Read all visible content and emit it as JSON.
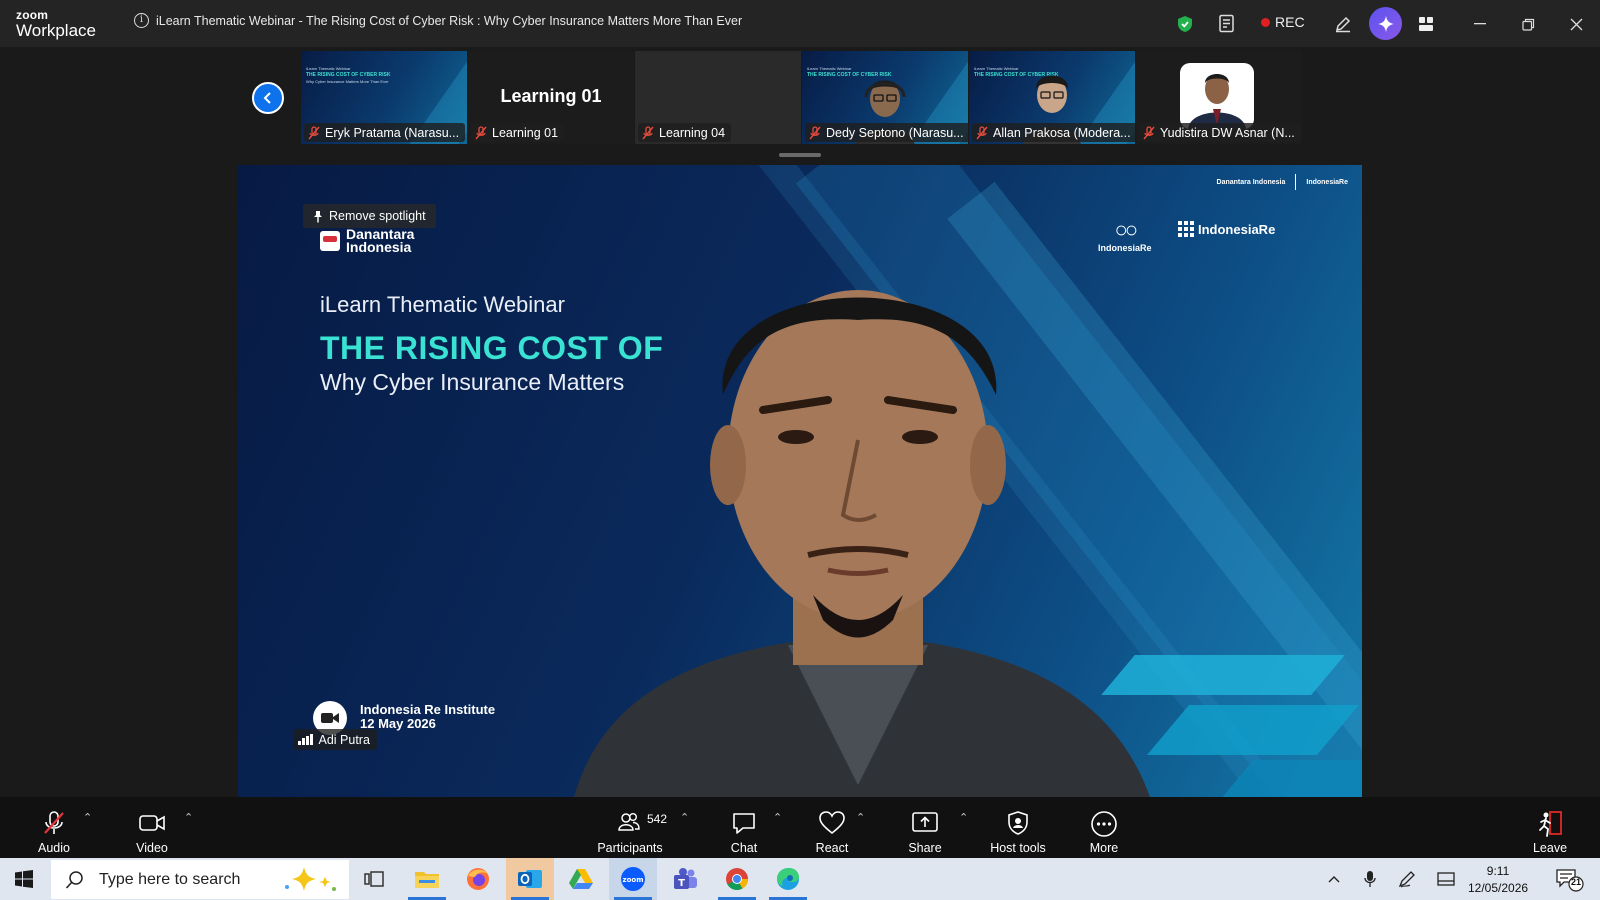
{
  "app": {
    "brand_top": "zoom",
    "brand_bottom": "Workplace",
    "window_title": "iLearn Thematic Webinar - The Rising Cost of Cyber Risk : Why Cyber Insurance Matters More Than Ever",
    "rec_label": "REC"
  },
  "gallery": {
    "tiles": [
      {
        "name": "Eryk Pratama (Narasu...",
        "kind": "slide"
      },
      {
        "name": "Learning 01",
        "kind": "name",
        "big": "Learning 01"
      },
      {
        "name": "Learning 04",
        "kind": "empty"
      },
      {
        "name": "Dedy Septono (Narasu...",
        "kind": "slide-person"
      },
      {
        "name": "Allan Prakosa (Modera...",
        "kind": "slide-person"
      },
      {
        "name": "Yudistira DW Asnar (N...",
        "kind": "photo"
      }
    ],
    "slide_mini": {
      "l1": "iLearn Thematic Webinar",
      "l2": "THE RISING COST OF CYBER RISK",
      "l3": "Why Cyber Insurance Matters More Than Ever"
    }
  },
  "main": {
    "spotlight_label": "Remove spotlight",
    "danantara": "Danantara\nIndonesia",
    "webinar_title": "iLearn Thematic Webinar",
    "headline": "THE RISING COST OF",
    "subline": "Why Cyber Insurance Matters",
    "re_logo": "IndonesiaRe",
    "rei_logo": "IndonesiaRe",
    "mini_logo_1": "Danantara Indonesia",
    "mini_logo_2": "IndonesiaRe",
    "org_name": "Indonesia Re Institute",
    "org_date": "12 May 2026",
    "speaker": "Adi Putra"
  },
  "toolbar": {
    "audio": "Audio",
    "video": "Video",
    "participants": "Participants",
    "participant_count": "542",
    "chat": "Chat",
    "react": "React",
    "share": "Share",
    "host_tools": "Host tools",
    "more": "More",
    "leave": "Leave"
  },
  "taskbar": {
    "search_placeholder": "Type here to search",
    "time": "9:11",
    "date": "12/05/2026",
    "notif_count": "21"
  },
  "colors": {
    "zoom_blue": "#0e72ed",
    "slide_teal": "#39e2d2",
    "rec_red": "#e02020",
    "leave_red": "#e02828"
  }
}
